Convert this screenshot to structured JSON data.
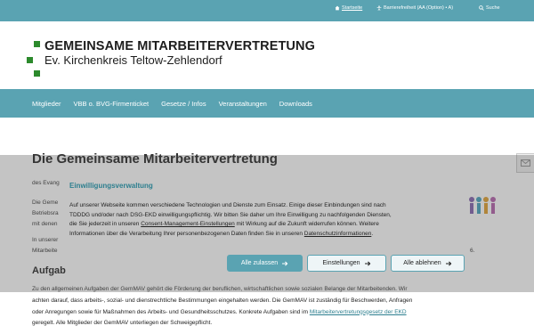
{
  "topbar": {
    "start": "Startseite",
    "accessibility": "Barrierefreiheit (AA (Option) • A)",
    "search": "Suche"
  },
  "header": {
    "title": "GEMEINSAME MITARBEITERVERTRETUNG",
    "subtitle": "Ev. Kirchenkreis Teltow-Zehlendorf",
    "brand_color": "#2c8a2c"
  },
  "nav": {
    "items": [
      "Mitglieder",
      "VBB o. BVG-Firmenticket",
      "Gesetze / Infos",
      "Veranstaltungen",
      "Downloads"
    ]
  },
  "content": {
    "page_title": "Die Gemeinsame Mitarbeitervertretung",
    "para1": "des Evang",
    "para2a": "Die Geme",
    "para2b": "Betriebsra",
    "para2c": "mit denen",
    "para3a": "In unserer",
    "para3b": "Mitarbeite",
    "para3c": "6.",
    "section_heading": "Aufgab",
    "partial_line": "Zu den allgemeinen Aufgaben der GemMAV gehört die Förderung der beruflichen, wirtschaftlichen sowie sozialen Belange der Mitarbeitenden. Wir",
    "footer_line1": "achten darauf, dass arbeits-, sozial- und dienstrechtliche Bestimmungen eingehalten werden. Die GemMAV ist zuständig für Beschwerden, Anfragen",
    "footer_line2_prefix": "oder Anregungen sowie für Maßnahmen des Arbeits- und Gesundheitsschutzes. Konkrete Aufgaben sind im ",
    "footer_link": "Mitarbeitervertretungsgesetz der EKD",
    "footer_line3": "geregelt. Alle Mitglieder der GemMAV unterliegen der Schweigepflicht."
  },
  "consent": {
    "title": "Einwilligungsverwaltung",
    "line1": "Auf unserer Webseite kommen verschiedene Technologien und Dienste zum Einsatz. Einige dieser Einbindungen sind nach",
    "line2": "TDDDG und/oder nach DSG-EKD einwilligungspflichtig. Wir bitten Sie daher um Ihre Einwilligung zu nachfolgenden Diensten,",
    "line3_prefix": "die Sie jederzeit in unseren ",
    "line3_link": "Consent-Management-Einstellungen",
    "line3_suffix": " mit Wirkung auf die Zukunft widerrufen können. Weitere",
    "line4_prefix": "Informationen über die Verarbeitung Ihrer personenbezogenen Daten finden Sie in unseren ",
    "line4_link": "Datenschutzinformationen",
    "line4_suffix": ".",
    "accept_label": "Alle zulassen",
    "settings_label": "Einstellungen",
    "reject_label": "Alle ablehnen",
    "accent_color": "#5aa3b2"
  }
}
